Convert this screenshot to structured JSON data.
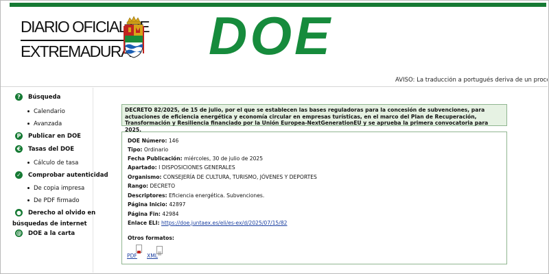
{
  "header": {
    "logo_line1": "DIARIO OFICIAL DE",
    "logo_line2": "EXTREMADURA",
    "brand": "DOE",
    "aviso": "AVISO: La traducción a portugués deriva de un proceso automático"
  },
  "nav": {
    "busqueda": "Búsqueda",
    "calendario": "Calendario",
    "avanzada": "Avanzada",
    "publicar": "Publicar en DOE",
    "tasas": "Tasas del DOE",
    "calculo": "Cálculo de tasa",
    "comprobar": "Comprobar autenticidad",
    "copia_impresa": "De copia impresa",
    "pdf_firmado": "De PDF firmado",
    "olvido_line1": "Derecho al olvido en",
    "olvido_line2": "búsquedas de internet",
    "carta": "DOE a la carta"
  },
  "decreto_title": "DECRETO 82/2025, de 15 de julio, por el que se establecen las bases reguladoras para la concesión de subvenciones, para actuaciones de eficiencia energética y economía circular en empresas turísticas, en el marco del Plan de Recuperación, Transformación y Resiliencia financiado por la Unión Europea-NextGenerationEU y se aprueba la primera convocatoria para 2025.",
  "details": {
    "numero_label": "DOE Número:",
    "numero": "146",
    "tipo_label": "Tipo:",
    "tipo": "Ordinario",
    "fecha_label": "Fecha Publicación:",
    "fecha": "miércoles, 30 de julio de 2025",
    "apartado_label": "Apartado:",
    "apartado": "I DISPOSICIONES GENERALES",
    "organismo_label": "Organismo:",
    "organismo": "CONSEJERÍA DE CULTURA, TURISMO, JÓVENES Y DEPORTES",
    "rango_label": "Rango:",
    "rango": "DECRETO",
    "descriptores_label": "Descriptores:",
    "descriptores": "Eficiencia energética. Subvenciones.",
    "pag_inicio_label": "Página Inicio:",
    "pag_inicio": "42897",
    "pag_fin_label": "Página Fin:",
    "pag_fin": "42984",
    "eli_label": "Enlace ELI:",
    "eli": "https://doe.juntaex.es/eli/es-ex/d/2025/07/15/82",
    "otros_label": "Otros formatos:",
    "pdf": "PDF",
    "xml": "XML"
  },
  "colors": {
    "brand_green": "#168b3c",
    "title_bg": "#e6f2e3",
    "border": "#8fb58f",
    "link": "#1a3fa0"
  }
}
